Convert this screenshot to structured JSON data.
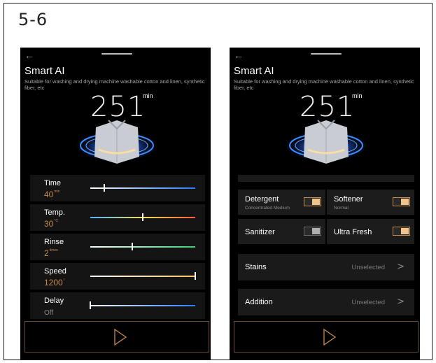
{
  "page_label": "5-6",
  "screens": [
    {
      "back_icon": "←",
      "title": "Smart AI",
      "subtitle": "Suitable for washing and drying machine washable cotton and linen, synthetic fiber, etc",
      "time_value": "251",
      "time_unit": "min",
      "sliders": [
        {
          "label": "Time",
          "value": "40",
          "unit": "min",
          "level": 0.13
        },
        {
          "label": "Temp.",
          "value": "30",
          "unit": "°C",
          "level": 0.5
        },
        {
          "label": "Rinse",
          "value": "2",
          "unit": "times",
          "level": 0.4
        },
        {
          "label": "Speed",
          "value": "1200",
          "unit": "r",
          "level": 1.0
        },
        {
          "label": "Delay",
          "value": "Off",
          "unit": "",
          "level": 0.0
        }
      ],
      "start_icon": "play-icon"
    },
    {
      "back_icon": "←",
      "title": "Smart AI",
      "subtitle": "Suitable for washing and drying machine washable cotton and linen, synthetic fiber, etc",
      "time_value": "251",
      "time_unit": "min",
      "options": {
        "detergent": {
          "label": "Detergent",
          "sub": "Concentrated Medium",
          "on": true
        },
        "softener": {
          "label": "Softener",
          "sub": "Normal",
          "on": true
        },
        "sanitizer": {
          "label": "Sanitizer",
          "on": false
        },
        "ultra_fresh": {
          "label": "Ultra Fresh",
          "on": true
        }
      },
      "stains": {
        "label": "Stains",
        "value": "Unselected"
      },
      "addition": {
        "label": "Addition",
        "value": "Unselected"
      },
      "start_icon": "play-icon"
    }
  ],
  "colors": {
    "accent": "#c78a4a",
    "toggle_on": "#f0c48a",
    "background": "#000000"
  }
}
